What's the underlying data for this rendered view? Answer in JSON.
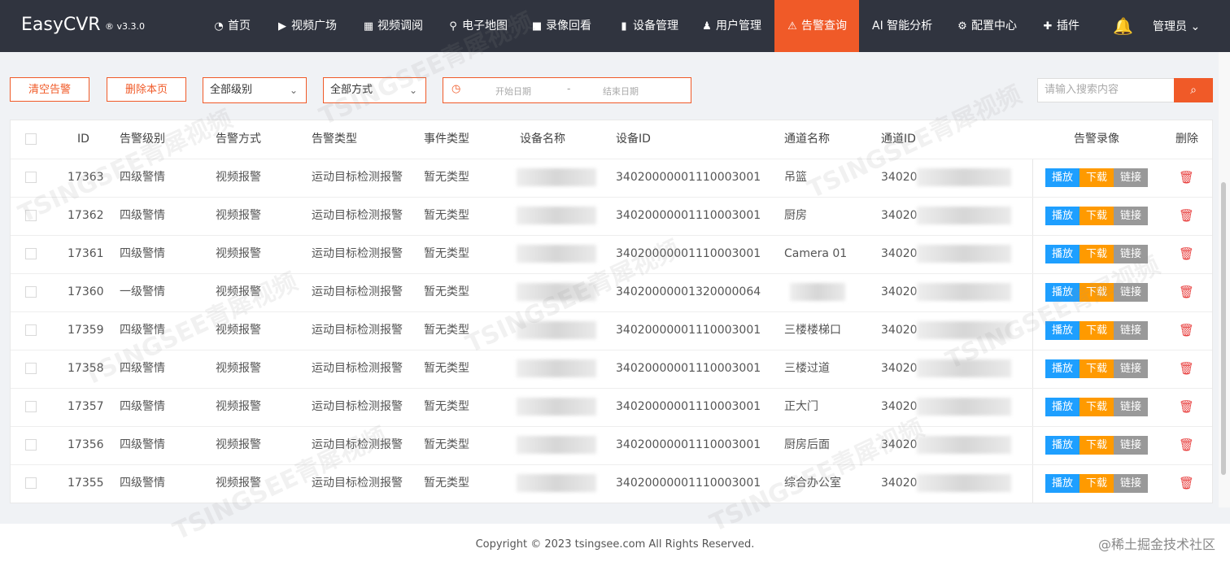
{
  "brand": {
    "name": "EasyCVR",
    "version": "® v3.3.0"
  },
  "nav": {
    "items": [
      {
        "label": "首页",
        "icon": "dashboard-icon",
        "glyph": "◔"
      },
      {
        "label": "视频广场",
        "icon": "play-circle-icon",
        "glyph": "▶"
      },
      {
        "label": "视频调阅",
        "icon": "grid-icon",
        "glyph": "▦"
      },
      {
        "label": "电子地图",
        "icon": "map-pin-icon",
        "glyph": "⚲"
      },
      {
        "label": "录像回看",
        "icon": "video-camera-icon",
        "glyph": "■"
      },
      {
        "label": "设备管理",
        "icon": "device-icon",
        "glyph": "▮"
      },
      {
        "label": "用户管理",
        "icon": "user-icon",
        "glyph": "♟"
      },
      {
        "label": "告警查询",
        "icon": "alarm-icon",
        "glyph": "⚠"
      },
      {
        "label": "AI 智能分析",
        "icon": "",
        "glyph": ""
      },
      {
        "label": "配置中心",
        "icon": "gear-icon",
        "glyph": "⚙"
      },
      {
        "label": "插件",
        "icon": "puzzle-icon",
        "glyph": "✚"
      }
    ],
    "active": "告警查询",
    "user": "管理员 ⌄",
    "accent": "#f05a28"
  },
  "toolbar": {
    "clear_label": "清空告警",
    "delete_page_label": "删除本页",
    "level_select": "全部级别",
    "method_select": "全部方式",
    "start_date_placeholder": "开始日期",
    "date_sep": "-",
    "end_date_placeholder": "结束日期",
    "search_placeholder": "请输入搜索内容"
  },
  "table": {
    "columns": [
      "ID",
      "告警级别",
      "告警方式",
      "告警类型",
      "事件类型",
      "设备名称",
      "设备ID",
      "通道名称",
      "通道ID",
      "告警录像",
      "删除"
    ],
    "rows": [
      {
        "id": "17363",
        "level": "四级警情",
        "method": "视频报警",
        "type": "运动目标检测报警",
        "event": "暂无类型",
        "device_id": "34020000001110003001",
        "channel": "吊篮",
        "channel_id": "34020"
      },
      {
        "id": "17362",
        "level": "四级警情",
        "method": "视频报警",
        "type": "运动目标检测报警",
        "event": "暂无类型",
        "device_id": "34020000001110003001",
        "channel": "厨房",
        "channel_id": "34020"
      },
      {
        "id": "17361",
        "level": "四级警情",
        "method": "视频报警",
        "type": "运动目标检测报警",
        "event": "暂无类型",
        "device_id": "34020000001110003001",
        "channel": "Camera 01",
        "channel_id": "34020"
      },
      {
        "id": "17360",
        "level": "一级警情",
        "method": "视频报警",
        "type": "运动目标检测报警",
        "event": "暂无类型",
        "device_id": "34020000001320000064",
        "channel": "",
        "channel_id": "34020"
      },
      {
        "id": "17359",
        "level": "四级警情",
        "method": "视频报警",
        "type": "运动目标检测报警",
        "event": "暂无类型",
        "device_id": "34020000001110003001",
        "channel": "三楼楼梯口",
        "channel_id": "34020"
      },
      {
        "id": "17358",
        "level": "四级警情",
        "method": "视频报警",
        "type": "运动目标检测报警",
        "event": "暂无类型",
        "device_id": "34020000001110003001",
        "channel": "三楼过道",
        "channel_id": "34020"
      },
      {
        "id": "17357",
        "level": "四级警情",
        "method": "视频报警",
        "type": "运动目标检测报警",
        "event": "暂无类型",
        "device_id": "34020000001110003001",
        "channel": "正大门",
        "channel_id": "34020"
      },
      {
        "id": "17356",
        "level": "四级警情",
        "method": "视频报警",
        "type": "运动目标检测报警",
        "event": "暂无类型",
        "device_id": "34020000001110003001",
        "channel": "厨房后面",
        "channel_id": "34020"
      },
      {
        "id": "17355",
        "level": "四级警情",
        "method": "视频报警",
        "type": "运动目标检测报警",
        "event": "暂无类型",
        "device_id": "34020000001110003001",
        "channel": "综合办公室",
        "channel_id": "34020"
      }
    ],
    "actions": {
      "play": "播放",
      "download": "下载",
      "link": "链接"
    },
    "action_colors": {
      "play": "#1e9fff",
      "download": "#ff9a00",
      "link": "#999999",
      "delete": "#e8403f"
    }
  },
  "footer": {
    "copyright": "Copyright © 2023 tsingsee.com All Rights Reserved.",
    "source": "@稀土掘金技术社区"
  },
  "watermark": "TSINGSEE青犀视频"
}
